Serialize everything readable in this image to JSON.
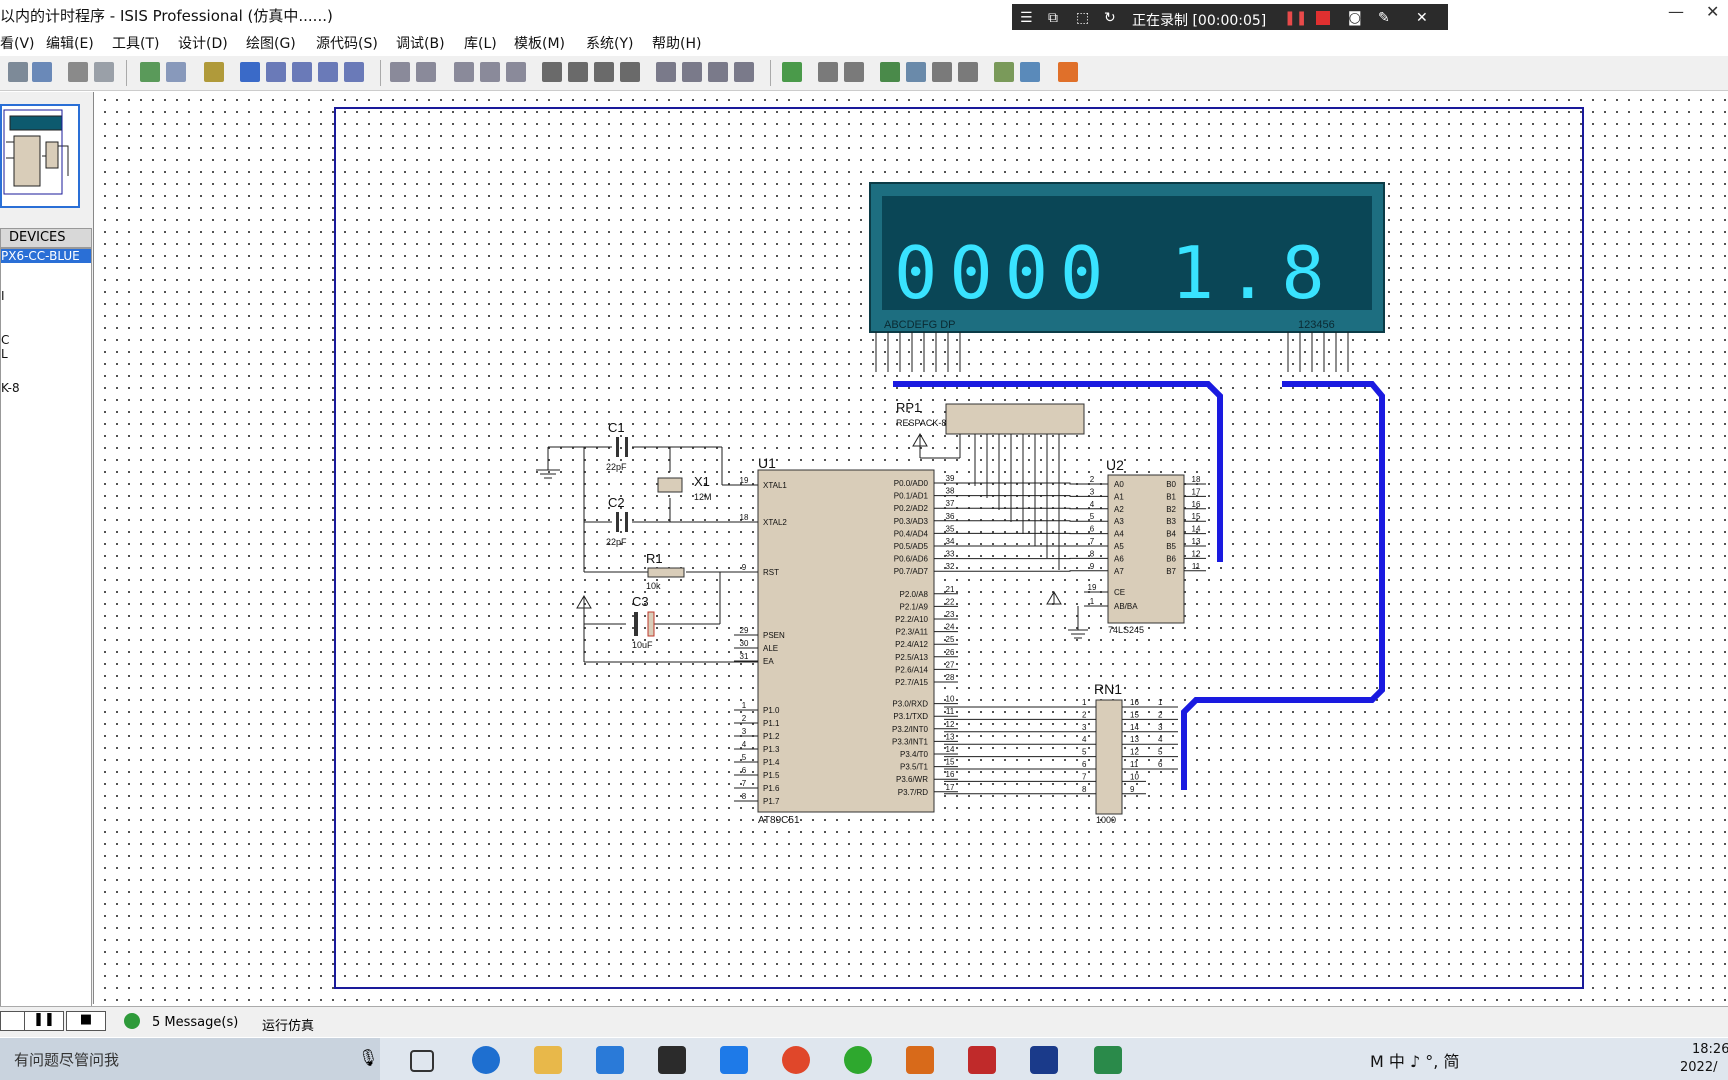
{
  "window": {
    "title": "以内的计时程序 - ISIS Professional (仿真中......)",
    "minimize": "—",
    "close": "✕"
  },
  "recorder": {
    "status": "正在录制 [00:00:05]"
  },
  "menu": {
    "items": [
      "看(V)",
      "编辑(E)",
      "工具(T)",
      "设计(D)",
      "绘图(G)",
      "源代码(S)",
      "调试(B)",
      "库(L)",
      "模板(M)",
      "系统(Y)",
      "帮助(H)"
    ]
  },
  "devices": {
    "header": "DEVICES",
    "items": [
      "PX6-CC-BLUE",
      "I",
      "C",
      "L",
      "K-8"
    ]
  },
  "schematic": {
    "display": {
      "digits": "0000 1.8",
      "label_left": "ABCDEFG  DP",
      "label_right": "123456"
    },
    "components": {
      "c1": "C1",
      "c1_val": "22pF",
      "c2": "C2",
      "c2_val": "22pF",
      "x1": "X1",
      "x1_val": "12M",
      "r1": "R1",
      "r1_val": "10k",
      "c3": "C3",
      "c3_val": "10uF",
      "rp1": "RP1",
      "rp1_val": "RESPACK-8",
      "u1": "U1",
      "u1_part": "AT89C51",
      "u2": "U2",
      "u2_part": "74LS245",
      "rn1": "RN1",
      "rn1_val": "1000"
    },
    "u1_left_pins": [
      {
        "num": "19",
        "name": "XTAL1"
      },
      {
        "num": "18",
        "name": "XTAL2"
      },
      {
        "num": "9",
        "name": "RST"
      },
      {
        "num": "29",
        "name": "PSEN"
      },
      {
        "num": "30",
        "name": "ALE"
      },
      {
        "num": "31",
        "name": "EA"
      },
      {
        "num": "1",
        "name": "P1.0"
      },
      {
        "num": "2",
        "name": "P1.1"
      },
      {
        "num": "3",
        "name": "P1.2"
      },
      {
        "num": "4",
        "name": "P1.3"
      },
      {
        "num": "5",
        "name": "P1.4"
      },
      {
        "num": "6",
        "name": "P1.5"
      },
      {
        "num": "7",
        "name": "P1.6"
      },
      {
        "num": "8",
        "name": "P1.7"
      }
    ],
    "u1_right_pins": [
      {
        "num": "39",
        "name": "P0.0/AD0"
      },
      {
        "num": "38",
        "name": "P0.1/AD1"
      },
      {
        "num": "37",
        "name": "P0.2/AD2"
      },
      {
        "num": "36",
        "name": "P0.3/AD3"
      },
      {
        "num": "35",
        "name": "P0.4/AD4"
      },
      {
        "num": "34",
        "name": "P0.5/AD5"
      },
      {
        "num": "33",
        "name": "P0.6/AD6"
      },
      {
        "num": "32",
        "name": "P0.7/AD7"
      },
      {
        "num": "21",
        "name": "P2.0/A8"
      },
      {
        "num": "22",
        "name": "P2.1/A9"
      },
      {
        "num": "23",
        "name": "P2.2/A10"
      },
      {
        "num": "24",
        "name": "P2.3/A11"
      },
      {
        "num": "25",
        "name": "P2.4/A12"
      },
      {
        "num": "26",
        "name": "P2.5/A13"
      },
      {
        "num": "27",
        "name": "P2.6/A14"
      },
      {
        "num": "28",
        "name": "P2.7/A15"
      },
      {
        "num": "10",
        "name": "P3.0/RXD"
      },
      {
        "num": "11",
        "name": "P3.1/TXD"
      },
      {
        "num": "12",
        "name": "P3.2/INT0"
      },
      {
        "num": "13",
        "name": "P3.3/INT1"
      },
      {
        "num": "14",
        "name": "P3.4/T0"
      },
      {
        "num": "15",
        "name": "P3.5/T1"
      },
      {
        "num": "16",
        "name": "P3.6/WR"
      },
      {
        "num": "17",
        "name": "P3.7/RD"
      }
    ],
    "u2_left_pins": [
      {
        "num": "2",
        "name": "A0"
      },
      {
        "num": "3",
        "name": "A1"
      },
      {
        "num": "4",
        "name": "A2"
      },
      {
        "num": "5",
        "name": "A3"
      },
      {
        "num": "6",
        "name": "A4"
      },
      {
        "num": "7",
        "name": "A5"
      },
      {
        "num": "8",
        "name": "A6"
      },
      {
        "num": "9",
        "name": "A7"
      },
      {
        "num": "19",
        "name": "CE"
      },
      {
        "num": "1",
        "name": "AB/BA"
      }
    ],
    "u2_right_pins": [
      {
        "num": "18",
        "name": "B0"
      },
      {
        "num": "17",
        "name": "B1"
      },
      {
        "num": "16",
        "name": "B2"
      },
      {
        "num": "15",
        "name": "B3"
      },
      {
        "num": "14",
        "name": "B4"
      },
      {
        "num": "13",
        "name": "B5"
      },
      {
        "num": "12",
        "name": "B6"
      },
      {
        "num": "11",
        "name": "B7"
      }
    ],
    "rn1_left": [
      "1",
      "2",
      "3",
      "4",
      "5",
      "6",
      "7",
      "8"
    ],
    "rn1_right": [
      "16",
      "15",
      "14",
      "13",
      "12",
      "11",
      "10",
      "9"
    ],
    "rn1_out": [
      "1",
      "2",
      "3",
      "4",
      "5",
      "6"
    ]
  },
  "status": {
    "messages": "5 Message(s)",
    "state": "运行仿真"
  },
  "taskbar": {
    "search": "有问题尽管问我",
    "tray": "M 中 ♪ °, 简",
    "time": "18:26",
    "date": "2022/"
  },
  "colors": {
    "bus": "#1a1ae0",
    "lcd_bg": "#0d5a6e",
    "lcd_seg": "#39e3ff",
    "chip": "#d9cdb9",
    "wire": "#1e1e1e"
  }
}
